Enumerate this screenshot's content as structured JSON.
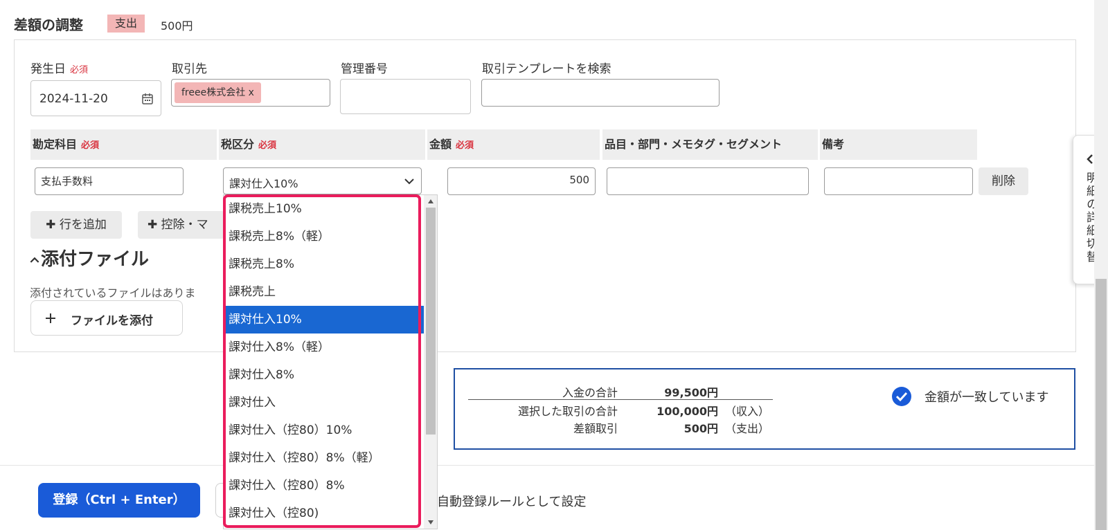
{
  "header": {
    "title": "差額の調整",
    "type_badge": "支出",
    "amount": "500円"
  },
  "form": {
    "date": {
      "label": "発生日",
      "required": "必須",
      "value": "2024-11-20"
    },
    "partner": {
      "label": "取引先",
      "tag": "freee株式会社 x"
    },
    "management_number": {
      "label": "管理番号",
      "value": ""
    },
    "template_search": {
      "label": "取引テンプレートを検索",
      "value": ""
    }
  },
  "table": {
    "headers": {
      "account": "勘定科目",
      "tax": "税区分",
      "amount": "金額",
      "items": "品目・部門・メモタグ・セグメント",
      "remarks": "備考",
      "required": "必須"
    },
    "row": {
      "account": "支払手数料",
      "tax": "課対仕入10%",
      "amount": "500",
      "items": "",
      "remarks": "",
      "delete_label": "削除"
    }
  },
  "buttons": {
    "add_row": "✚ 行を追加",
    "deduction": "✚ 控除・マ",
    "attach_file": "ファイルを添付",
    "submit": "登録（Ctrl + Enter）"
  },
  "attachment": {
    "section_title": "添付ファイル",
    "empty_text": "添付されているファイルはありま"
  },
  "summary": {
    "rows": [
      {
        "label": "入金の合計",
        "value": "99,500円",
        "note": ""
      },
      {
        "label": "選択した取引の合計",
        "value": "100,000円",
        "note": "（収入）"
      },
      {
        "label": "差額取引",
        "value": "500円",
        "note": "（支出）"
      }
    ],
    "match_text": "金額が一致しています"
  },
  "footer": {
    "rule_text": "自動登録ルールとして設定"
  },
  "side_tab": {
    "label": "明細の詳細切替"
  },
  "dropdown": {
    "selected": "課対仕入10%",
    "options": [
      "課税売上10%",
      "課税売上8%（軽）",
      "課税売上8%",
      "課税売上",
      "課対仕入10%",
      "課対仕入8%（軽）",
      "課対仕入8%",
      "課対仕入",
      "課対仕入（控80）10%",
      "課対仕入（控80）8%（軽）",
      "課対仕入（控80）8%",
      "課対仕入（控80)"
    ]
  },
  "colors": {
    "accent_blue": "#1a5bd8",
    "badge_pink": "#f3b6b6",
    "required_red": "#d9333f",
    "highlight": "#ea1c5c",
    "summary_border": "#1f4fa3"
  }
}
